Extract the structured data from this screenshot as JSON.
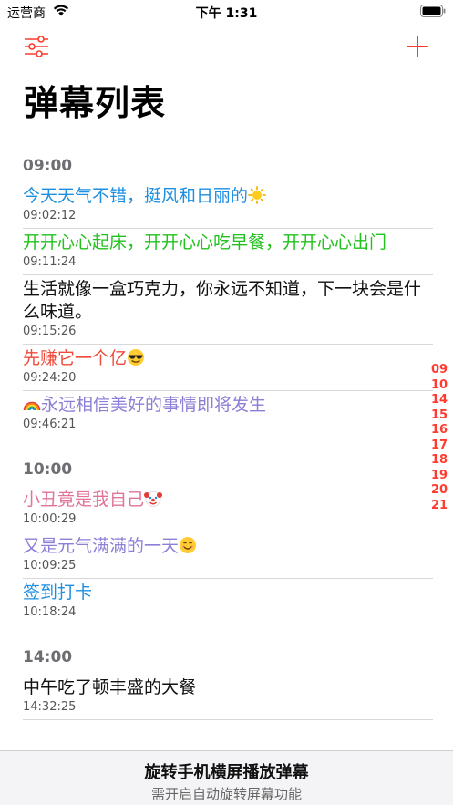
{
  "status_bar": {
    "carrier": "运营商",
    "time": "下午 1:31"
  },
  "header": {
    "title": "弹幕列表"
  },
  "colors": {
    "accent": "#ff3b30"
  },
  "sections": [
    {
      "title": "09:00",
      "items": [
        {
          "text": "今天天气不错，挺风和日丽的",
          "emoji": "sun",
          "time": "09:02:12",
          "color": "#1e8fe0"
        },
        {
          "text": "开开心心起床，开开心心吃早餐，开开心心出门",
          "emoji": "",
          "time": "09:11:24",
          "color": "#22c21e"
        },
        {
          "text": "生活就像一盒巧克力，你永远不知道，下一块会是什么味道。",
          "emoji": "",
          "time": "09:15:26",
          "color": "#111111"
        },
        {
          "text": "先赚它一个亿",
          "emoji": "sunglasses",
          "time": "09:24:20",
          "color": "#ef4b3a"
        },
        {
          "text": "永远相信美好的事情即将发生",
          "emoji": "rainbow",
          "emoji_first": true,
          "time": "09:46:21",
          "color": "#8b7fd6"
        }
      ]
    },
    {
      "title": "10:00",
      "items": [
        {
          "text": "小丑竟是我自己",
          "emoji": "clown",
          "time": "10:00:29",
          "color": "#e0739a"
        },
        {
          "text": "又是元气满满的一天",
          "emoji": "smile",
          "time": "10:09:25",
          "color": "#8b7fd6"
        },
        {
          "text": "签到打卡",
          "emoji": "",
          "time": "10:18:24",
          "color": "#1e8fe0"
        }
      ]
    },
    {
      "title": "14:00",
      "items": [
        {
          "text": "中午吃了顿丰盛的大餐",
          "emoji": "",
          "time": "14:32:25",
          "color": "#111111"
        }
      ]
    }
  ],
  "index": [
    "09",
    "10",
    "14",
    "15",
    "16",
    "17",
    "18",
    "19",
    "20",
    "21"
  ],
  "bottom_bar": {
    "title": "旋转手机横屏播放弹幕",
    "subtitle": "需开启自动旋转屏幕功能"
  }
}
